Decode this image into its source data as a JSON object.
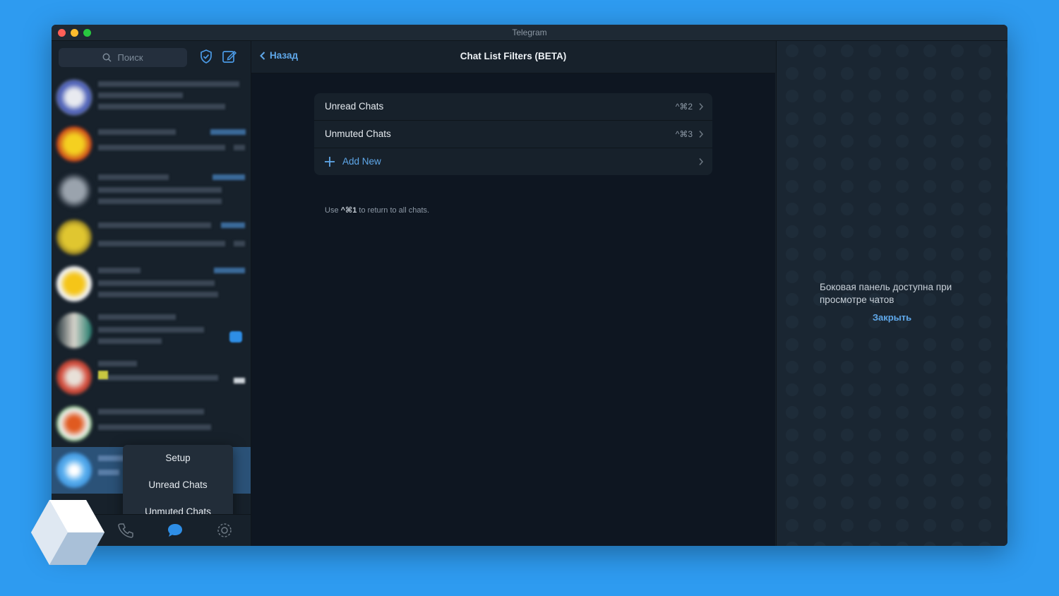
{
  "window": {
    "title": "Telegram"
  },
  "sidebar": {
    "search_placeholder": "Поиск",
    "context_menu": [
      "Setup",
      "Unread Chats",
      "Unmuted Chats"
    ]
  },
  "header": {
    "back_label": "Назад",
    "title": "Chat List Filters (BETA)"
  },
  "filters": [
    {
      "label": "Unread Chats",
      "shortcut": "^⌘2"
    },
    {
      "label": "Unmuted Chats",
      "shortcut": "^⌘3"
    }
  ],
  "add_new_label": "Add New",
  "hint": {
    "prefix": "Use ",
    "shortcut": "^⌘1",
    "suffix": " to return to all chats."
  },
  "right_panel": {
    "text": "Боковая панель доступна при просмотре чатов",
    "link": "Закрыть"
  },
  "colors": {
    "accent": "#5fa8ea",
    "background": "#2e9bf0",
    "sidebar": "#17212b",
    "main": "#0e1621"
  },
  "icons": [
    "search-icon",
    "shield-icon",
    "compose-icon",
    "back-chevron-icon",
    "chevron-right-icon",
    "plus-icon",
    "contacts-icon",
    "phone-icon",
    "chats-icon",
    "settings-icon"
  ]
}
